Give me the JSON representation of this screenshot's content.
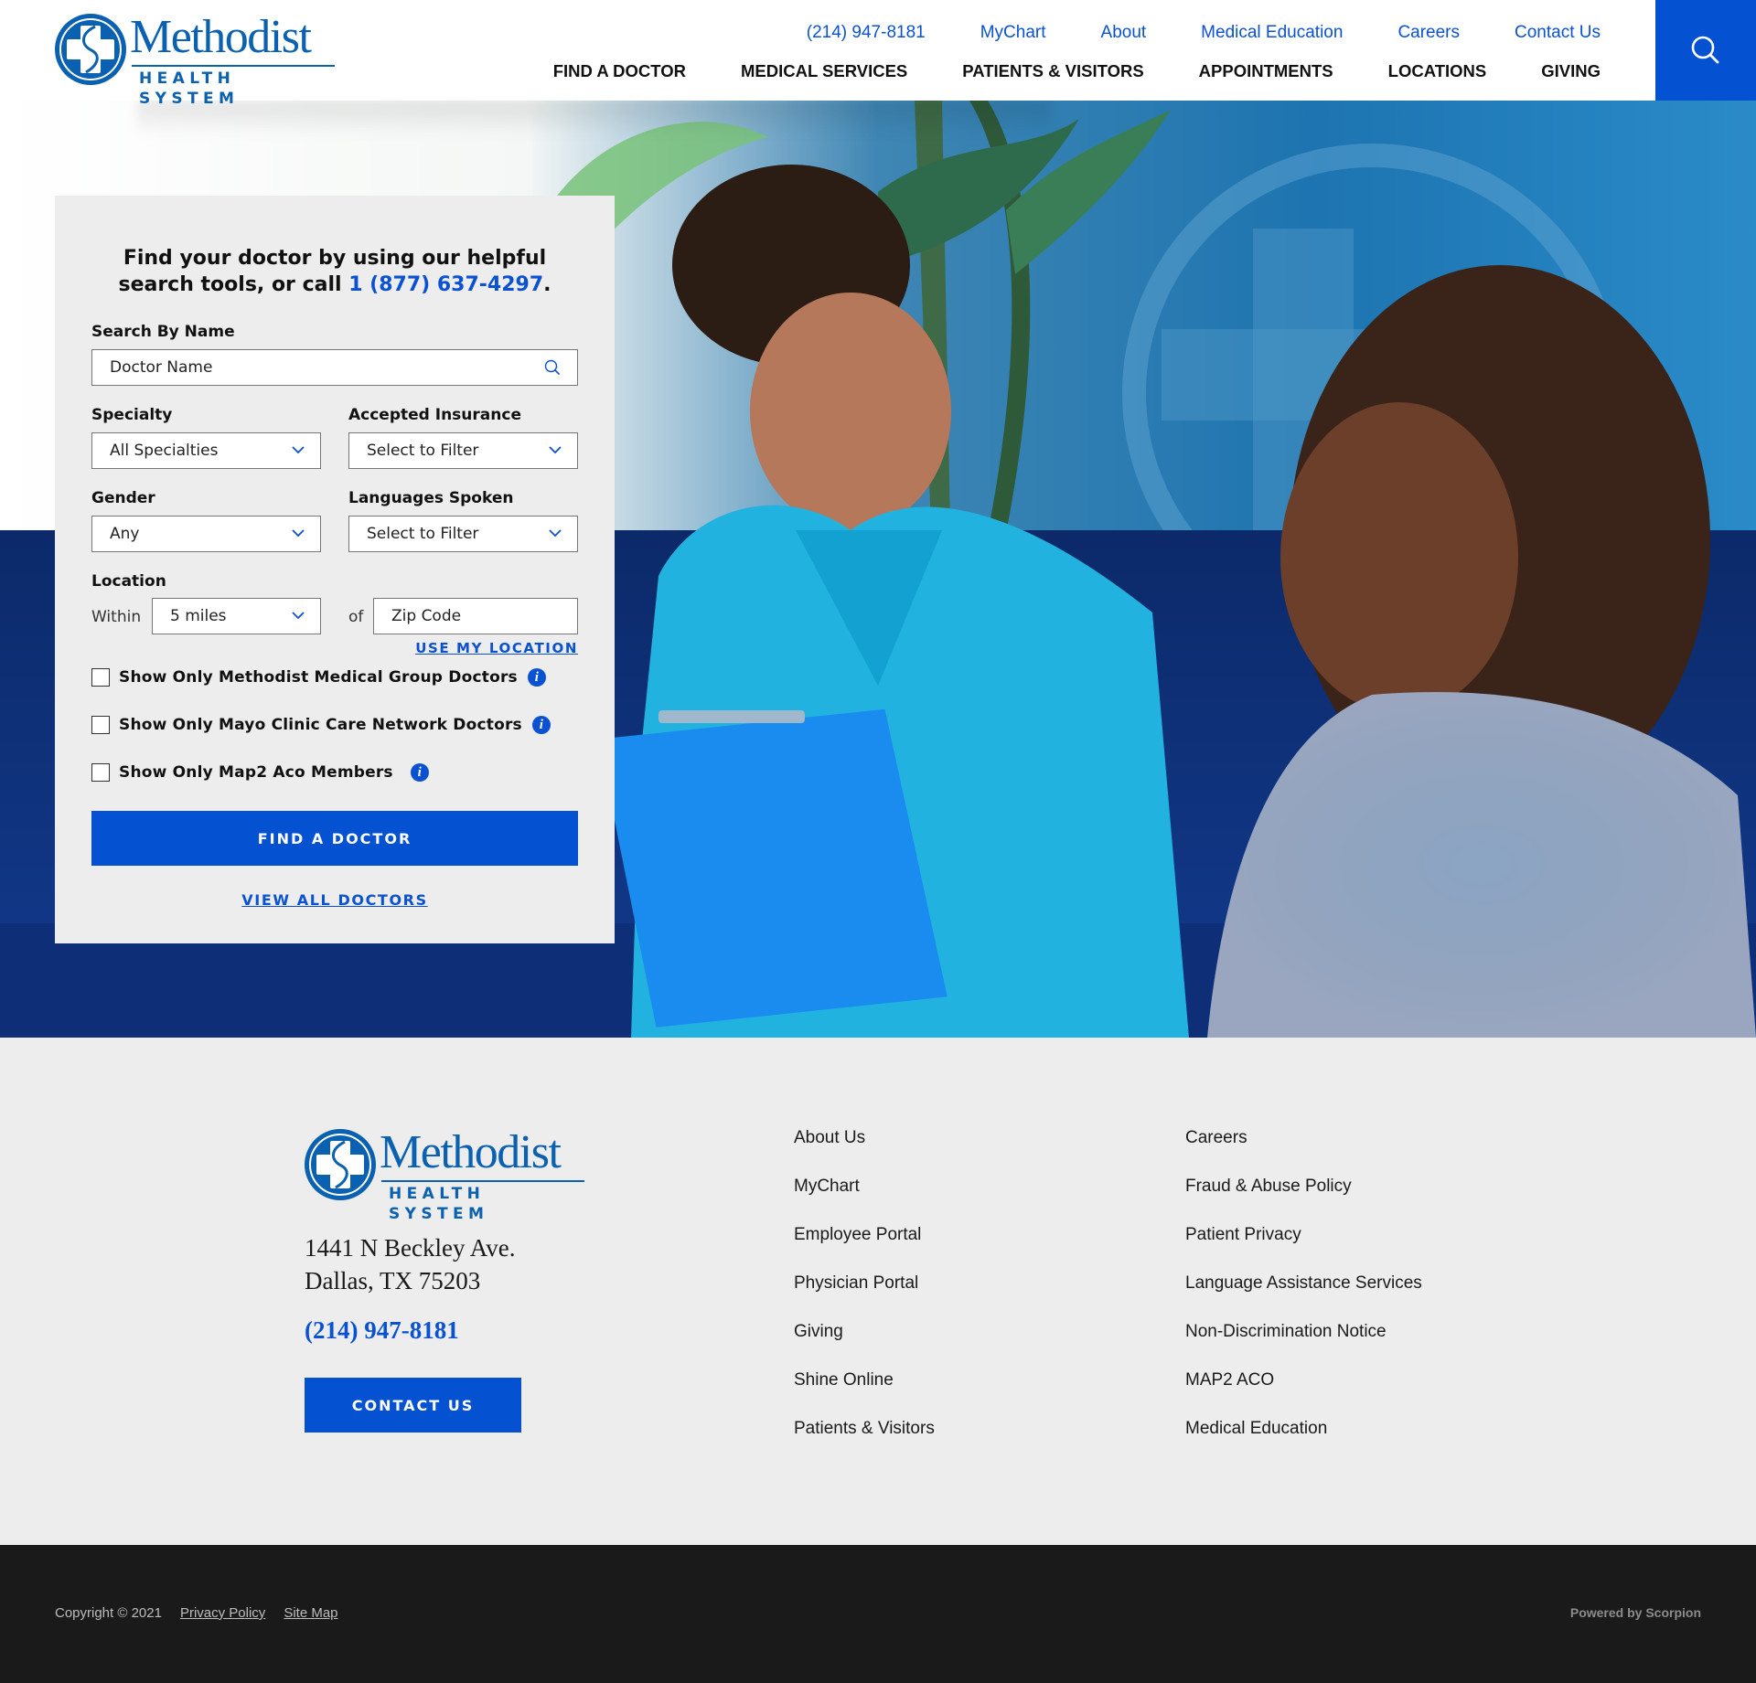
{
  "header": {
    "logo": {
      "word": "Methodist",
      "sub": "HEALTH SYSTEM"
    },
    "utility_nav": [
      {
        "label": "(214) 947-8181"
      },
      {
        "label": "MyChart"
      },
      {
        "label": "About"
      },
      {
        "label": "Medical Education"
      },
      {
        "label": "Careers"
      },
      {
        "label": "Contact Us"
      }
    ],
    "main_nav": [
      {
        "label": "FIND A DOCTOR"
      },
      {
        "label": "MEDICAL SERVICES"
      },
      {
        "label": "PATIENTS & VISITORS"
      },
      {
        "label": "APPOINTMENTS"
      },
      {
        "label": "LOCATIONS"
      },
      {
        "label": "GIVING"
      }
    ],
    "search_icon": "search-icon"
  },
  "hero": {
    "image_description": "Smiling nurse in teal Methodist scrubs holding a blue clipboard, seated on a navy sofa beside a smiling older woman in a patterned blouse; blue wall with large Methodist logo and a plant behind"
  },
  "finder": {
    "title_line1": "Find your doctor by using our helpful",
    "title_line2": "search tools, or call ",
    "title_phone": "1 (877) 637-4297",
    "title_end": ".",
    "search_name": {
      "label": "Search By Name",
      "placeholder": "Doctor Name"
    },
    "specialty": {
      "label": "Specialty",
      "value": "All Specialties"
    },
    "insurance": {
      "label": "Accepted Insurance",
      "value": "Select to Filter"
    },
    "gender": {
      "label": "Gender",
      "value": "Any"
    },
    "languages": {
      "label": "Languages Spoken",
      "value": "Select to Filter"
    },
    "location": {
      "label": "Location",
      "within": "Within",
      "distance": "5 miles",
      "of": "of",
      "zip_placeholder": "Zip Code",
      "use_my_location": "USE MY LOCATION"
    },
    "checkboxes": [
      {
        "label": "Show Only Methodist Medical Group Doctors",
        "checked": false
      },
      {
        "label": "Show Only Mayo Clinic Care Network Doctors",
        "checked": false
      },
      {
        "label": "Show Only Map2 Aco Members",
        "checked": false
      }
    ],
    "find_button": "FIND A DOCTOR",
    "view_all": "VIEW ALL DOCTORS"
  },
  "footer": {
    "logo": {
      "word": "Methodist",
      "sub": "HEALTH SYSTEM"
    },
    "address_line1": "1441 N Beckley Ave.",
    "address_line2": "Dallas, TX 75203",
    "phone": "(214) 947-8181",
    "contact_button": "CONTACT US",
    "links_col1": [
      "About Us",
      "MyChart",
      "Employee Portal",
      "Physician Portal",
      "Giving",
      "Shine Online",
      "Patients & Visitors"
    ],
    "links_col2": [
      "Careers",
      "Fraud & Abuse Policy",
      "Patient Privacy",
      "Language Assistance Services",
      "Non-Discrimination Notice",
      "MAP2 ACO",
      "Medical Education"
    ]
  },
  "bottom_bar": {
    "copyright": "Copyright © 2021",
    "privacy": "Privacy Policy",
    "sitemap": "Site Map",
    "powered": "Powered by Scorpion"
  },
  "colors": {
    "brand_blue": "#0452d1",
    "link_blue": "#0a52d2",
    "logo_blue": "#0b61b1",
    "panel_bg": "#ededed",
    "footer_bg": "#ededed",
    "bottom_bg": "#1a1a1a"
  }
}
